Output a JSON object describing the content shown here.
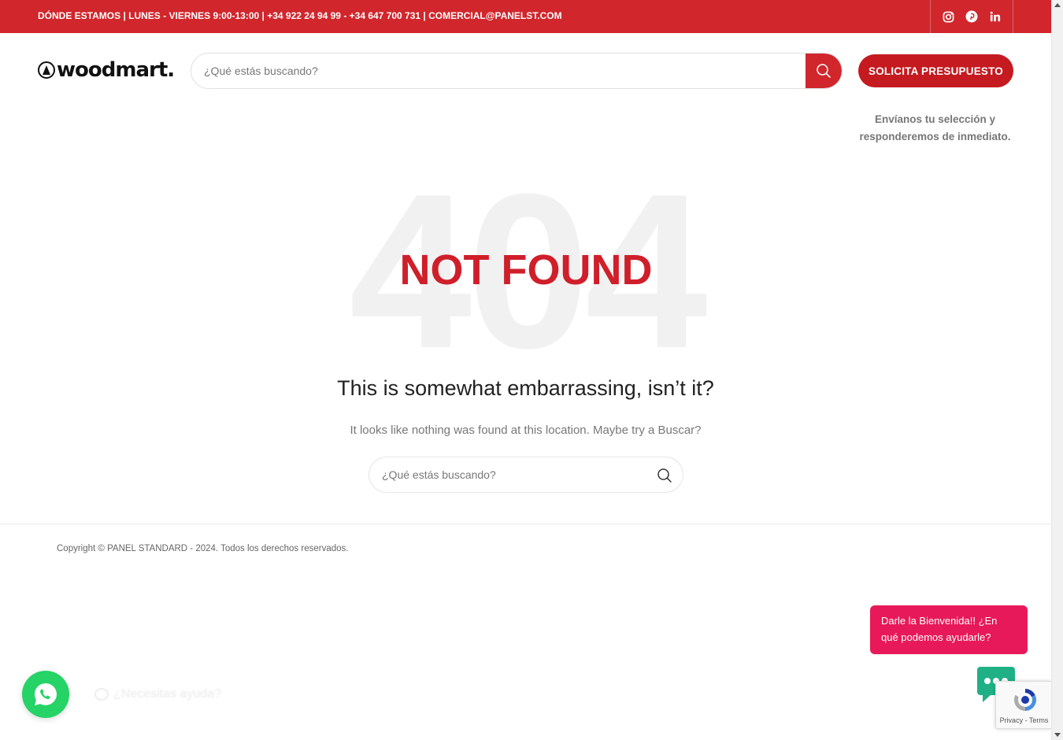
{
  "topbar": {
    "info": "DÓNDE ESTAMOS | LUNES - VIERNES 9:00-13:00 | +34 922 24 94 99 - +34 647 700 731 | COMERCIAL@PANELST.COM",
    "social": [
      "instagram-icon",
      "pinterest-icon",
      "linkedin-icon"
    ],
    "background": "#d0262c"
  },
  "header": {
    "logo_text": "woodmart.",
    "search_placeholder": "¿Qué estás buscando?",
    "quote_button": "SOLICITA PRESUPUESTO",
    "quote_sub_line1": "Envíanos tu selección y",
    "quote_sub_line2": "responderemos de inmediato."
  },
  "main": {
    "big_number": "404",
    "not_found": "NOT FOUND",
    "headline": "This is somewhat embarrassing, isn’t it?",
    "description": "It looks like nothing was found at this location. Maybe try a Buscar?",
    "search_placeholder": "¿Qué estás buscando?"
  },
  "footer": {
    "copyright": "Copyright © PANEL STANDARD - 2024. Todos los derechos reservados."
  },
  "whatsapp": {
    "label": "¿Necesitas ayuda?"
  },
  "chat": {
    "greeting": "Darle la Bienvenida!! ¿En qué podemos ayudarle?",
    "bubble_color": "#e8195a",
    "launcher_color": "#1fb185"
  },
  "recaptcha": {
    "privacy": "Privacy",
    "terms": "Terms"
  },
  "colors": {
    "accent": "#d0262c",
    "not_found": "#cf1f2a"
  }
}
